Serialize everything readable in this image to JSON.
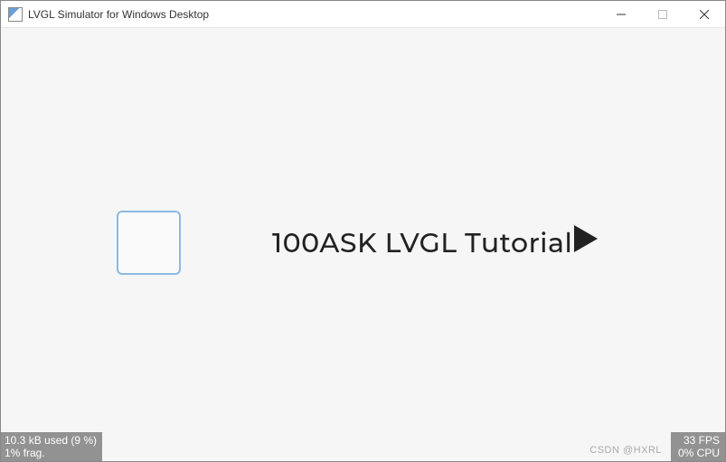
{
  "window": {
    "title": "LVGL Simulator for Windows Desktop"
  },
  "content": {
    "tutorial_label": "100ASK LVGL Tutorial"
  },
  "status": {
    "memory": "10.3 kB used (9 %)",
    "frag": "1% frag.",
    "fps": "33 FPS",
    "cpu": "0% CPU"
  },
  "watermark": "CSDN @HXRL"
}
